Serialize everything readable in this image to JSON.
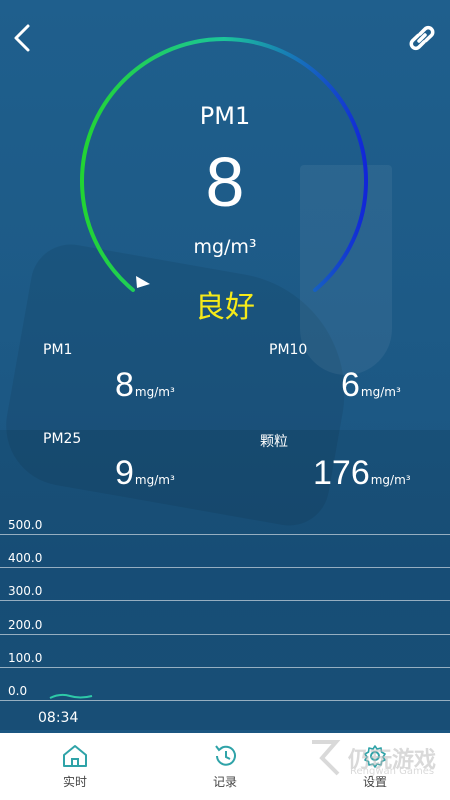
{
  "header": {
    "back_icon": "chevron-left-icon",
    "link_icon": "link-icon"
  },
  "gauge": {
    "label": "PM1",
    "value": "8",
    "unit": "mg/m³",
    "quality": "良好",
    "colors": {
      "start": "#22d433",
      "end": "#1226d8",
      "quality": "#f5ea19"
    }
  },
  "readings": [
    {
      "label": "PM1",
      "value": "8",
      "unit": "mg/m³"
    },
    {
      "label": "PM10",
      "value": "6",
      "unit": "mg/m³"
    },
    {
      "label": "PM25",
      "value": "9",
      "unit": "mg/m³"
    },
    {
      "label": "颗粒",
      "value": "176",
      "unit": "mg/m³"
    }
  ],
  "chart": {
    "y_ticks": [
      "500.0",
      "400.0",
      "300.0",
      "200.0",
      "100.0",
      "0.0"
    ],
    "time_label": "08:34",
    "line_color": "#2ec9a8"
  },
  "nav": {
    "items": [
      {
        "label": "实时",
        "icon": "home-icon"
      },
      {
        "label": "记录",
        "icon": "history-icon"
      },
      {
        "label": "设置",
        "icon": "gear-icon"
      }
    ]
  },
  "watermark": {
    "text": "仍玩游戏",
    "sub": "Rengwan Games"
  }
}
